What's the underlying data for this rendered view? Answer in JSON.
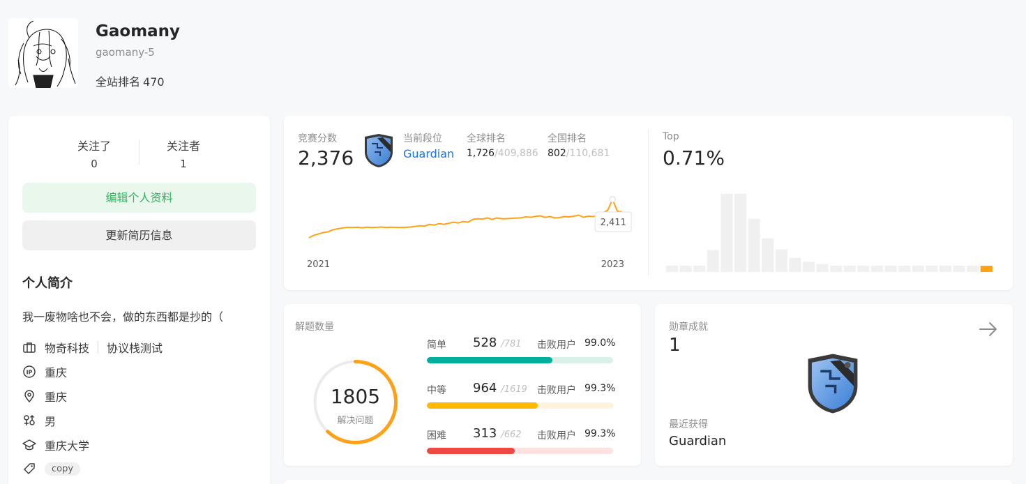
{
  "profile": {
    "name": "Gaomany",
    "handle": "gaomany-5",
    "rank_label": "全站排名",
    "rank_value": "470"
  },
  "follow": {
    "following_label": "关注了",
    "following_count": "0",
    "followers_label": "关注者",
    "followers_count": "1"
  },
  "buttons": {
    "edit_profile": "编辑个人资料",
    "update_resume": "更新简历信息"
  },
  "bio": {
    "title": "个人简介",
    "text": "我一废物啥也不会，做的东西都是抄的（"
  },
  "info": {
    "company": "物奇科技",
    "job": "协议栈测试",
    "ip_location": "重庆",
    "location": "重庆",
    "gender": "男",
    "school": "重庆大学",
    "tag": "copy"
  },
  "contest": {
    "score_label": "竞赛分数",
    "score": "2,376",
    "level_label": "当前段位",
    "level": "Guardian",
    "global_label": "全球排名",
    "global_rank": "1,726",
    "global_total": "/409,886",
    "national_label": "全国排名",
    "national_rank": "802",
    "national_total": "/110,681",
    "top_label": "Top",
    "top_value": "0.71%",
    "tooltip_value": "2,411",
    "x_start": "2021",
    "x_end": "2023"
  },
  "chart_data": [
    {
      "type": "line",
      "title": "",
      "xlabel": "",
      "ylabel": "",
      "x_ticks": [
        "2021",
        "2023"
      ],
      "series": [
        {
          "values": [
            1870,
            1905,
            1925,
            1945,
            1955,
            1985,
            1998,
            2010,
            2018,
            2015,
            2020,
            2012,
            2020,
            2015,
            2018,
            2022,
            2015,
            2020,
            2018,
            2015,
            2018,
            2022,
            2030,
            2040,
            2035,
            2060,
            2050,
            2070,
            2060,
            2075,
            2090,
            2080,
            2100,
            2090,
            2130,
            2140,
            2135,
            2150,
            2130,
            2150,
            2140,
            2140,
            2145,
            2148,
            2152,
            2165,
            2160,
            2172,
            2180,
            2158,
            2170,
            2150,
            2155,
            2170,
            2165,
            2175,
            2190,
            2160,
            2175,
            2170,
            2190,
            2220,
            2260,
            2411,
            2245,
            2235
          ]
        }
      ],
      "annotations": [
        "2,411"
      ],
      "color": "#ffa116"
    },
    {
      "type": "bar",
      "title": "",
      "xlabel": "",
      "ylabel": "",
      "values": [
        8,
        8,
        8,
        28,
        100,
        100,
        68,
        43,
        29,
        18,
        13,
        10,
        8,
        8,
        8,
        8,
        8,
        8,
        8,
        8,
        8,
        8,
        8,
        8
      ],
      "highlight_index": 23,
      "colors": {
        "bar": "#f0f0f0",
        "highlight": "#ffa116"
      }
    }
  ],
  "solved": {
    "title": "解题数量",
    "total": "1805",
    "total_label": "解决问题",
    "ring_fraction": 0.62,
    "beat_label": "击败用户",
    "difficulties": [
      {
        "name": "简单",
        "solved": "528",
        "total": "/781",
        "beat": "99.0%",
        "fraction": 0.676,
        "color": "#00af9b",
        "track": "#daf1ea"
      },
      {
        "name": "中等",
        "solved": "964",
        "total": "/1619",
        "beat": "99.3%",
        "fraction": 0.595,
        "color": "#ffb800",
        "track": "#fff3dc"
      },
      {
        "name": "困难",
        "solved": "313",
        "total": "/662",
        "beat": "99.3%",
        "fraction": 0.473,
        "color": "#ef4743",
        "track": "#fde2e1"
      }
    ]
  },
  "badges": {
    "title": "勋章成就",
    "count": "1",
    "recent_label": "最近获得",
    "recent_name": "Guardian"
  }
}
